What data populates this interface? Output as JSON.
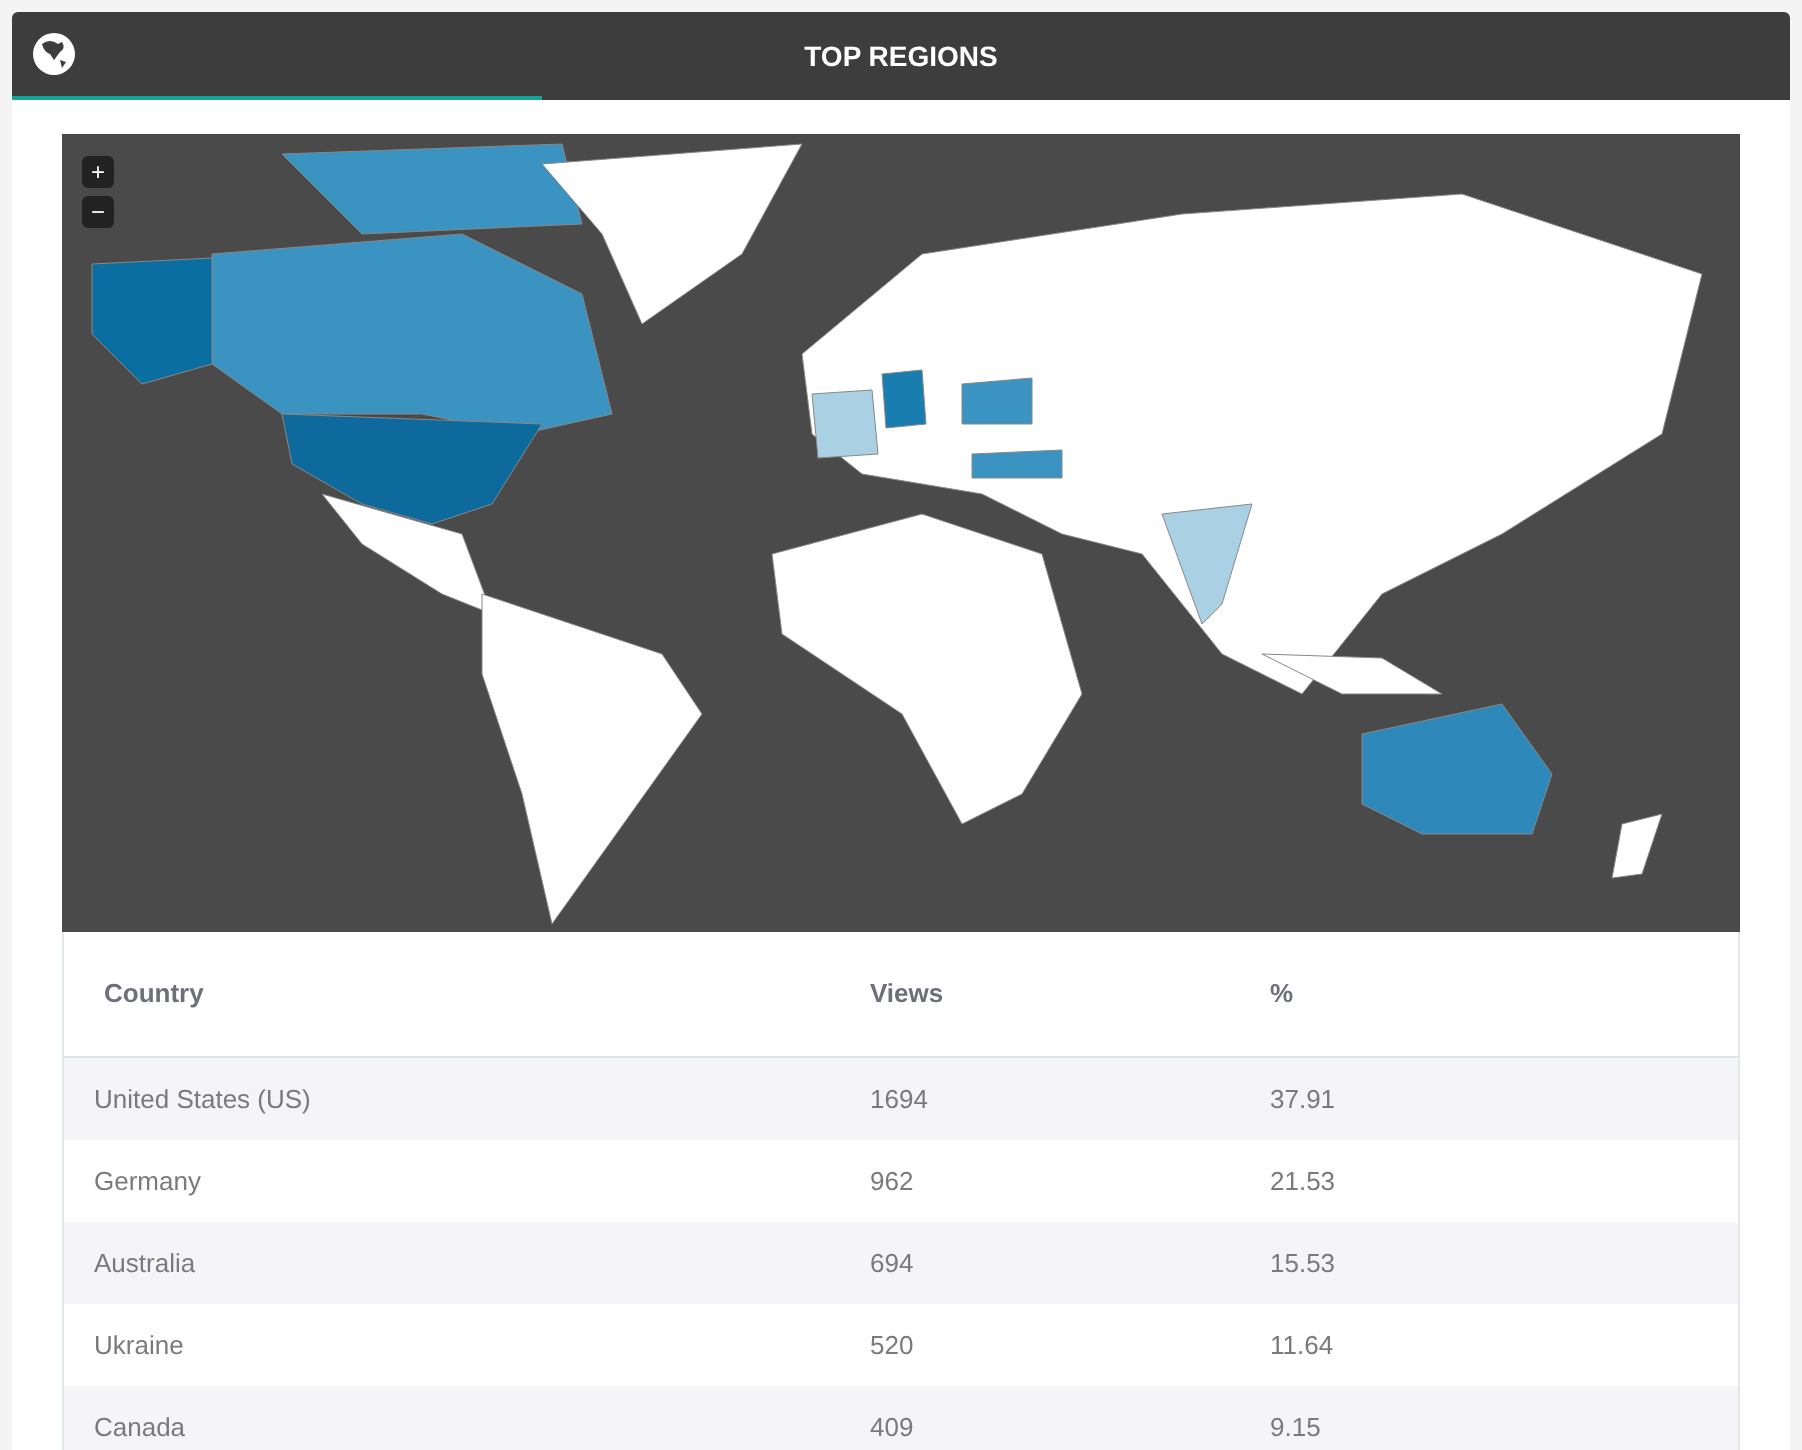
{
  "header": {
    "title": "TOP REGIONS"
  },
  "map": {
    "zoom_in": "+",
    "zoom_out": "−"
  },
  "table": {
    "columns": [
      "Country",
      "Views",
      "%"
    ],
    "rows": [
      [
        "United States (US)",
        "1694",
        "37.91"
      ],
      [
        "Germany",
        "962",
        "21.53"
      ],
      [
        "Australia",
        "694",
        "15.53"
      ],
      [
        "Ukraine",
        "520",
        "11.64"
      ],
      [
        "Canada",
        "409",
        "9.15"
      ]
    ]
  }
}
